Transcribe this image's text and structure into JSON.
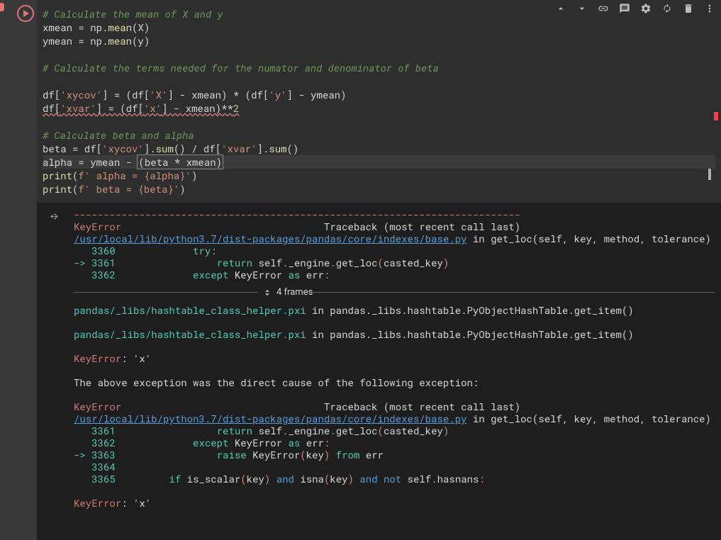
{
  "cell": {
    "code_lines": [
      {
        "type": "comment",
        "text": "# Calculate the mean of X and y"
      },
      {
        "type": "code",
        "html": "xmean = np.<fn>mean</fn>(X)"
      },
      {
        "type": "code",
        "html": "ymean = np.<fn>mean</fn>(y)"
      },
      {
        "type": "blank"
      },
      {
        "type": "comment",
        "text": "# Calculate the terms needed for the numator and denominator of beta"
      },
      {
        "type": "blank"
      },
      {
        "type": "code",
        "html": "df[<str>'xycov'</str>] = (df[<str>'X'</str>] - xmean) * (df[<str>'y'</str>] - ymean)"
      },
      {
        "type": "code-wavy",
        "html": "df[<str>'xvar'</str>] = (df[<str>'x'</str>] - xmean)**<num>2</num>"
      },
      {
        "type": "blank"
      },
      {
        "type": "comment",
        "text": "# Calculate beta and alpha"
      },
      {
        "type": "code",
        "html": "beta = df[<str>'xycov'</str>].<fn>sum</fn>() / df[<str>'xvar'</str>].<fn>sum</fn>()"
      },
      {
        "type": "current",
        "html": "alpha = ymean - <box>(beta * xmean)</box>"
      },
      {
        "type": "code",
        "html": "<fn>print</fn>(<str>f' alpha = {alpha}'</str>)"
      },
      {
        "type": "code",
        "html": "<fn>print</fn>(<str>f' beta = {beta}'</str>)"
      }
    ]
  },
  "output": {
    "dash_line": "---------------------------------------------------------------------------",
    "err1": "KeyError",
    "traceback": "Traceback (most recent call last)",
    "file1": "/usr/local/lib/python3.7/dist-packages/pandas/core/indexes/base.py",
    "method1": " in get_loc(self, key, method, tolerance)",
    "lines1": [
      {
        "ln": "   3360",
        "arrow": "   ",
        "code": "            <kwd>try</kwd><paren>:</paren>"
      },
      {
        "ln": "   3361",
        "arrow": "-> ",
        "code": "                <kwd>return</kwd> self<paren>.</paren>_engine<paren>.</paren>get_loc<paren>(</paren>casted_key<paren>)</paren>"
      },
      {
        "ln": "   3362",
        "arrow": "   ",
        "code": "            <kwd>except</kwd> KeyError <kwd>as</kwd> err<paren>:</paren>"
      }
    ],
    "frames_label": "4 frames",
    "hashtable1": "pandas/_libs/hashtable_class_helper.pxi",
    "hashtable1_tail": " in pandas._libs.hashtable.PyObjectHashTable.get_item()",
    "keyerr1": "KeyError",
    "keyerr1_val": ": 'x'",
    "above_exc": "The above exception was the direct cause of the following exception:",
    "lines2": [
      {
        "ln": "   3361",
        "arrow": "   ",
        "code": "                <kwd>return</kwd> self<paren>.</paren>_engine<paren>.</paren>get_loc<paren>(</paren>casted_key<paren>)</paren>"
      },
      {
        "ln": "   3362",
        "arrow": "   ",
        "code": "            <kwd>except</kwd> KeyError <kwd>as</kwd> err<paren>:</paren>"
      },
      {
        "ln": "   3363",
        "arrow": "-> ",
        "code": "                <kwd>raise</kwd> KeyError<paren>(</paren>key<paren>)</paren> <kwd>from</kwd> err"
      },
      {
        "ln": "   3364",
        "arrow": "   ",
        "code": ""
      },
      {
        "ln": "   3365",
        "arrow": "   ",
        "code": "        <kwd>if</kwd> is_scalar<paren>(</paren>key<paren>)</paren> <kwd2>and</kwd2> isna<paren>(</paren>key<paren>)</paren> <kwd2>and not</kwd2> self<paren>.</paren>hasnans<paren>:</paren>"
      }
    ]
  }
}
